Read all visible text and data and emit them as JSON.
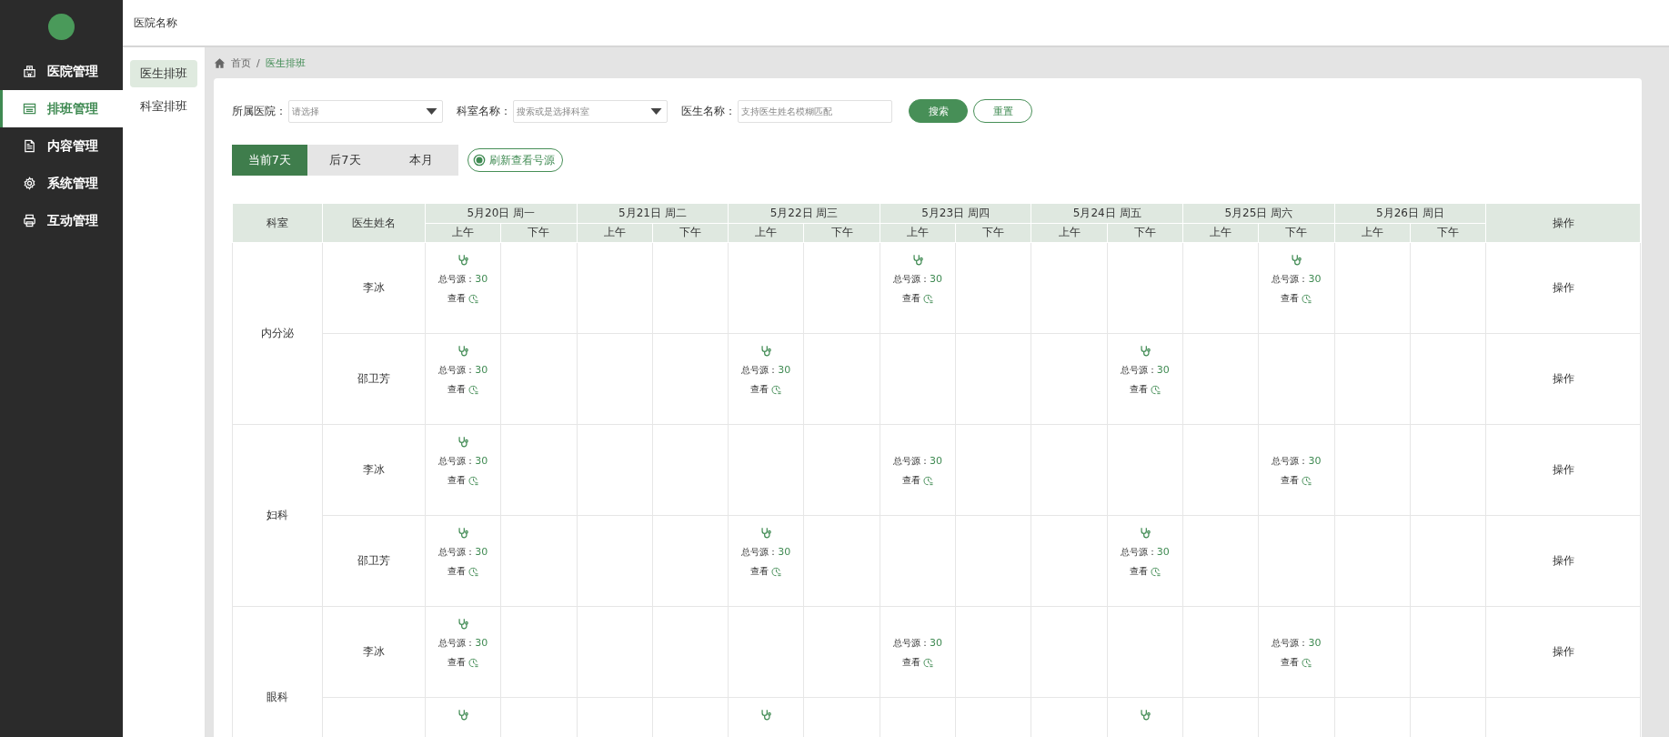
{
  "header": {
    "title": "医院名称"
  },
  "sidebar": {
    "items": [
      {
        "label": "医院管理",
        "selected": false,
        "kind": "hospital"
      },
      {
        "label": "排班管理",
        "selected": true,
        "kind": "calendar"
      },
      {
        "label": "内容管理",
        "selected": false,
        "kind": "document"
      },
      {
        "label": "系统管理",
        "selected": false,
        "kind": "gear"
      },
      {
        "label": "互动管理",
        "selected": false,
        "kind": "interact"
      }
    ]
  },
  "subnav": {
    "items": [
      {
        "label": "医生排班",
        "selected": true
      },
      {
        "label": "科室排班",
        "selected": false
      }
    ]
  },
  "breadcrumb": {
    "separator": "/",
    "items": [
      {
        "label": "首页",
        "current": false
      },
      {
        "label": "医生排班",
        "current": true
      }
    ]
  },
  "filters": [
    {
      "label": "所属医院：",
      "kind": "select",
      "placeholder": "请选择"
    },
    {
      "label": "科室名称：",
      "kind": "select",
      "placeholder": "搜索或是选择科室"
    },
    {
      "label": "医生名称：",
      "kind": "text",
      "placeholder": "支持医生姓名模糊匹配"
    }
  ],
  "buttons": [
    {
      "label": "搜索",
      "kind": "primary"
    },
    {
      "label": "重置",
      "kind": "outline"
    }
  ],
  "range_tabs": [
    {
      "label": "当前7天",
      "selected": true
    },
    {
      "label": "后7天",
      "selected": false
    },
    {
      "label": "本月",
      "selected": false
    }
  ],
  "refresh_button": {
    "label": "刷新查看号源"
  },
  "table": {
    "columns": {
      "department": "科室",
      "doctor": "医生姓名",
      "action": "操作"
    },
    "days": [
      {
        "label": "5月20日 周一",
        "halves": [
          "上午",
          "下午"
        ]
      },
      {
        "label": "5月21日 周二",
        "halves": [
          "上午",
          "下午"
        ]
      },
      {
        "label": "5月22日 周三",
        "halves": [
          "上午",
          "下午"
        ]
      },
      {
        "label": "5月23日 周四",
        "halves": [
          "上午",
          "下午"
        ]
      },
      {
        "label": "5月24日 周五",
        "halves": [
          "上午",
          "下午"
        ]
      },
      {
        "label": "5月25日 周六",
        "halves": [
          "上午",
          "下午"
        ]
      },
      {
        "label": "5月26日 周日",
        "halves": [
          "上午",
          "下午"
        ]
      }
    ],
    "groups": [
      {
        "department": "内分泌",
        "rows": [
          {
            "doctor": "李冰",
            "action": "操作",
            "slots": [
              {
                "kind": "source",
                "icon": true,
                "label": "总号源：",
                "count": "30",
                "link": "查看"
              },
              {
                "kind": "empty"
              },
              {
                "kind": "empty"
              },
              {
                "kind": "empty"
              },
              {
                "kind": "empty"
              },
              {
                "kind": "empty"
              },
              {
                "kind": "source",
                "icon": true,
                "label": "总号源：",
                "count": "30",
                "link": "查看"
              },
              {
                "kind": "empty"
              },
              {
                "kind": "empty"
              },
              {
                "kind": "empty"
              },
              {
                "kind": "empty"
              },
              {
                "kind": "source",
                "icon": true,
                "label": "总号源：",
                "count": "30",
                "link": "查看"
              },
              {
                "kind": "empty"
              },
              {
                "kind": "empty"
              }
            ]
          },
          {
            "doctor": "邵卫芳",
            "action": "操作",
            "slots": [
              {
                "kind": "source",
                "icon": true,
                "label": "总号源：",
                "count": "30",
                "link": "查看"
              },
              {
                "kind": "empty"
              },
              {
                "kind": "empty"
              },
              {
                "kind": "empty"
              },
              {
                "kind": "source",
                "icon": true,
                "label": "总号源：",
                "count": "30",
                "link": "查看"
              },
              {
                "kind": "empty"
              },
              {
                "kind": "empty"
              },
              {
                "kind": "empty"
              },
              {
                "kind": "empty"
              },
              {
                "kind": "source",
                "icon": true,
                "label": "总号源：",
                "count": "30",
                "link": "查看"
              },
              {
                "kind": "empty"
              },
              {
                "kind": "empty"
              },
              {
                "kind": "empty"
              },
              {
                "kind": "empty"
              }
            ]
          }
        ]
      },
      {
        "department": "妇科",
        "rows": [
          {
            "doctor": "李冰",
            "action": "操作",
            "slots": [
              {
                "kind": "source",
                "icon": true,
                "label": "总号源：",
                "count": "30",
                "link": "查看"
              },
              {
                "kind": "empty"
              },
              {
                "kind": "empty"
              },
              {
                "kind": "empty"
              },
              {
                "kind": "empty"
              },
              {
                "kind": "empty"
              },
              {
                "kind": "source",
                "icon": false,
                "label": "总号源：",
                "count": "30",
                "link": "查看"
              },
              {
                "kind": "empty"
              },
              {
                "kind": "empty"
              },
              {
                "kind": "empty"
              },
              {
                "kind": "empty"
              },
              {
                "kind": "source",
                "icon": false,
                "label": "总号源：",
                "count": "30",
                "link": "查看"
              },
              {
                "kind": "empty"
              },
              {
                "kind": "empty"
              }
            ]
          },
          {
            "doctor": "邵卫芳",
            "action": "操作",
            "slots": [
              {
                "kind": "source",
                "icon": true,
                "label": "总号源：",
                "count": "30",
                "link": "查看"
              },
              {
                "kind": "empty"
              },
              {
                "kind": "empty"
              },
              {
                "kind": "empty"
              },
              {
                "kind": "source",
                "icon": true,
                "label": "总号源：",
                "count": "30",
                "link": "查看"
              },
              {
                "kind": "empty"
              },
              {
                "kind": "empty"
              },
              {
                "kind": "empty"
              },
              {
                "kind": "empty"
              },
              {
                "kind": "source",
                "icon": true,
                "label": "总号源：",
                "count": "30",
                "link": "查看"
              },
              {
                "kind": "empty"
              },
              {
                "kind": "empty"
              },
              {
                "kind": "empty"
              },
              {
                "kind": "empty"
              }
            ]
          }
        ]
      },
      {
        "department": "眼科",
        "rows": [
          {
            "doctor": "李冰",
            "action": "操作",
            "slots": [
              {
                "kind": "source",
                "icon": true,
                "label": "总号源：",
                "count": "30",
                "link": "查看"
              },
              {
                "kind": "empty"
              },
              {
                "kind": "empty"
              },
              {
                "kind": "empty"
              },
              {
                "kind": "empty"
              },
              {
                "kind": "empty"
              },
              {
                "kind": "source",
                "icon": false,
                "label": "总号源：",
                "count": "30",
                "link": "查看"
              },
              {
                "kind": "empty"
              },
              {
                "kind": "empty"
              },
              {
                "kind": "empty"
              },
              {
                "kind": "empty"
              },
              {
                "kind": "source",
                "icon": false,
                "label": "总号源：",
                "count": "30",
                "link": "查看"
              },
              {
                "kind": "empty"
              },
              {
                "kind": "empty"
              }
            ]
          },
          {
            "slots": [
              {
                "kind": "source",
                "icon": true
              },
              {
                "kind": "empty"
              },
              {
                "kind": "empty"
              },
              {
                "kind": "empty"
              },
              {
                "kind": "source",
                "icon": true
              },
              {
                "kind": "empty"
              },
              {
                "kind": "empty"
              },
              {
                "kind": "empty"
              },
              {
                "kind": "empty"
              },
              {
                "kind": "source",
                "icon": true
              },
              {
                "kind": "empty"
              },
              {
                "kind": "empty"
              },
              {
                "kind": "empty"
              },
              {
                "kind": "empty"
              }
            ]
          }
        ]
      }
    ]
  }
}
